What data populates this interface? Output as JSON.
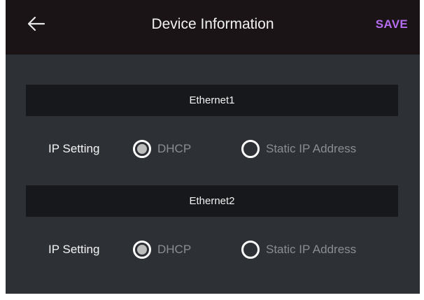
{
  "header": {
    "title": "Device Information",
    "back_icon": "arrow-left-icon",
    "save_label": "SAVE",
    "save_color": "#b46cf0"
  },
  "sections": [
    {
      "title": "Ethernet1",
      "ip_setting": {
        "label": "IP Setting",
        "options": [
          {
            "label": "DHCP",
            "selected": true
          },
          {
            "label": "Static IP Address",
            "selected": false
          }
        ]
      }
    },
    {
      "title": "Ethernet2",
      "ip_setting": {
        "label": "IP Setting",
        "options": [
          {
            "label": "DHCP",
            "selected": true
          },
          {
            "label": "Static IP Address",
            "selected": false
          }
        ]
      }
    }
  ],
  "colors": {
    "background": "#2d3136",
    "topbar": "#1b1416",
    "section_header": "#16181b",
    "accent": "#b46cf0"
  }
}
